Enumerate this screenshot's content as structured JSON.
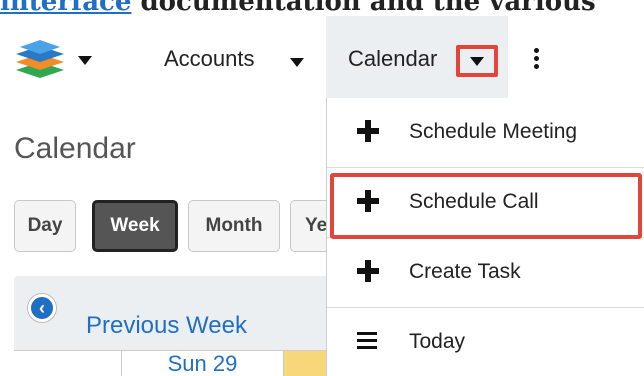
{
  "doc": {
    "link_text": "interface",
    "rest_text": " documentation and the various"
  },
  "nav": {
    "logo_icon": "stacked-layers-logo",
    "accounts_label": "Accounts",
    "calendar_label": "Calendar",
    "more_icon": "vertical-ellipsis"
  },
  "page": {
    "title": "Calendar",
    "view_buttons": [
      "Day",
      "Week",
      "Month",
      "Ye"
    ],
    "active_view": "Week",
    "prev_label": "Previous Week",
    "day_header": "Sun 29"
  },
  "dropdown": {
    "items": [
      {
        "label": "Schedule Meeting",
        "icon": "plus"
      },
      {
        "label": "Schedule Call",
        "icon": "plus"
      },
      {
        "label": "Create Task",
        "icon": "plus"
      },
      {
        "label": "Today",
        "icon": "hamburger"
      }
    ]
  },
  "colors": {
    "highlight": "#e2463b",
    "link": "#1f6fc5",
    "active_nav_bg": "#eceff2"
  }
}
